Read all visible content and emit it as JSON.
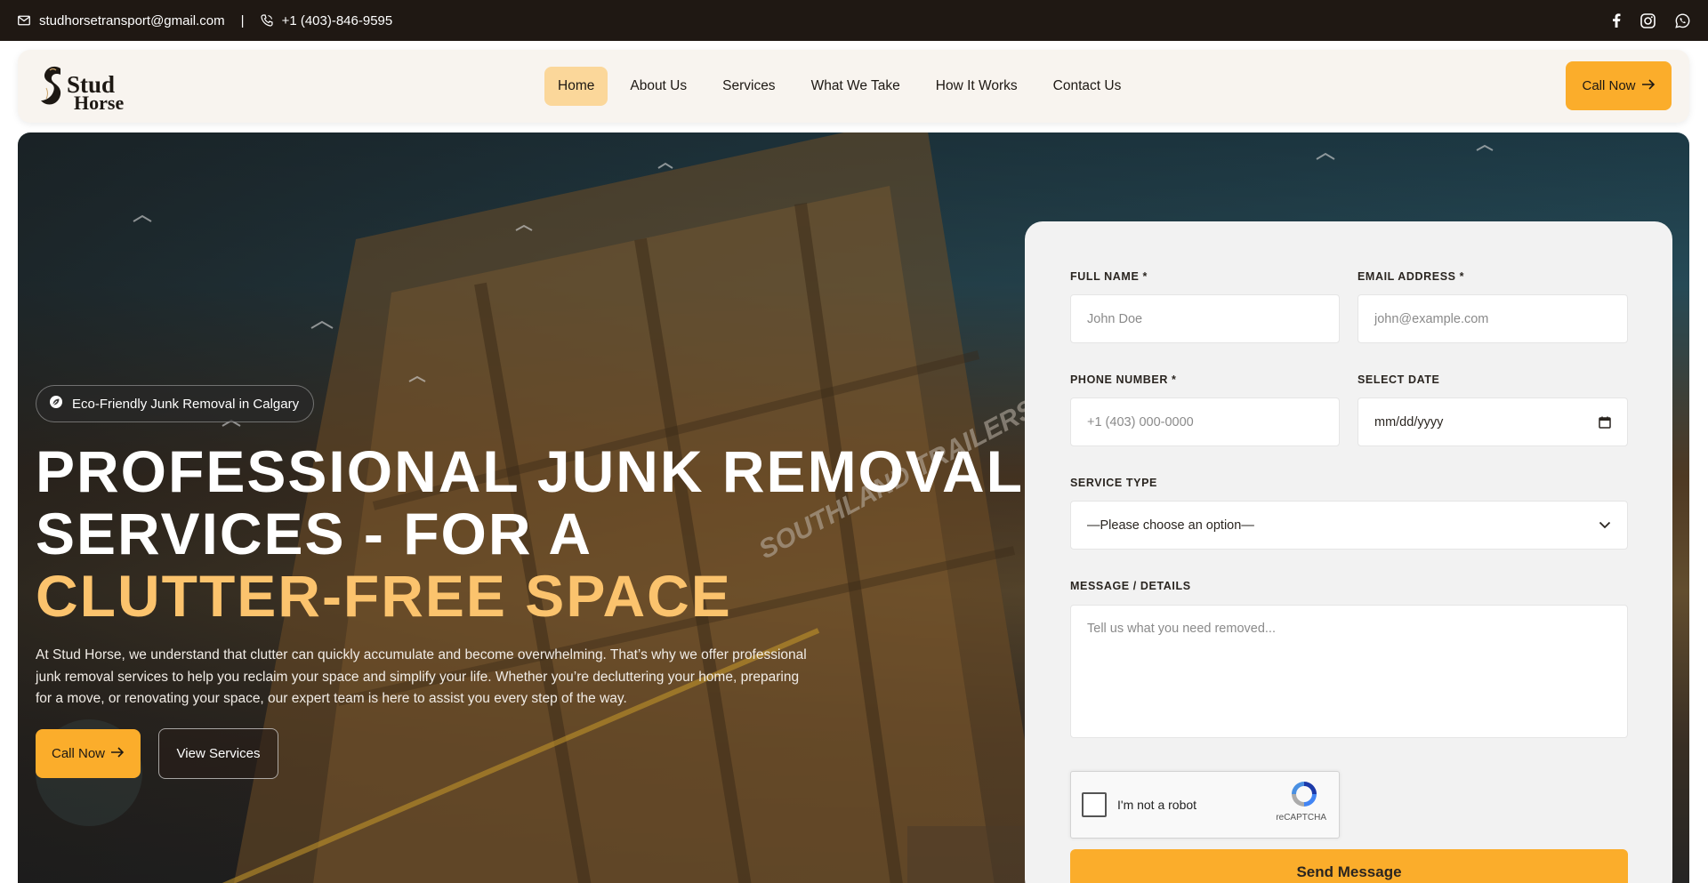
{
  "topbar": {
    "email": "studhorsetransport@gmail.com",
    "separator": "|",
    "phone": "+1 (403)-846-9595",
    "socials": [
      "facebook-icon",
      "instagram-icon",
      "whatsapp-icon"
    ]
  },
  "nav": {
    "logo_line1": "Stud",
    "logo_line2": "Horse",
    "items": [
      {
        "label": "Home",
        "active": true
      },
      {
        "label": "About Us"
      },
      {
        "label": "Services"
      },
      {
        "label": "What We Take"
      },
      {
        "label": "How It Works"
      },
      {
        "label": "Contact Us"
      }
    ],
    "cta_label": "Call Now"
  },
  "hero": {
    "badge": "Eco-Friendly Junk Removal in Calgary",
    "heading_line1": "PROFESSIONAL JUNK REMOVAL",
    "heading_line2": "SERVICES - FOR A",
    "heading_highlight": "CLUTTER-FREE SPACE",
    "paragraph": "At Stud Horse, we understand that clutter can quickly accumulate and become overwhelming. That’s why we offer professional junk removal services to help you reclaim your space and simplify your life. Whether you’re decluttering your home, preparing for a move, or renovating your space, our expert team is here to assist you every step of the way.",
    "call_button": "Call Now",
    "view_button": "View Services",
    "background_text": "SOUTHLAND TRAILERS"
  },
  "form": {
    "full_name": {
      "label": "FULL NAME *",
      "placeholder": "John Doe"
    },
    "email": {
      "label": "EMAIL ADDRESS *",
      "placeholder": "john@example.com"
    },
    "phone": {
      "label": "PHONE NUMBER *",
      "placeholder": "+1 (403) 000-0000"
    },
    "date": {
      "label": "SELECT DATE",
      "placeholder": "mm/dd/yyyy"
    },
    "service": {
      "label": "SERVICE TYPE",
      "selected": "—Please choose an option—"
    },
    "message": {
      "label": "MESSAGE / DETAILS",
      "placeholder": "Tell us what you need removed..."
    },
    "captcha": {
      "label": "I'm not a robot",
      "brand": "reCAPTCHA"
    },
    "submit": "Send Message"
  },
  "colors": {
    "accent": "#fbad2b",
    "accent_light": "#fbd79a",
    "highlight_text": "#fbc36d",
    "topbar_bg": "#1f1813",
    "nav_bg": "#f8f4ef",
    "form_bg": "#f2f2f2"
  }
}
